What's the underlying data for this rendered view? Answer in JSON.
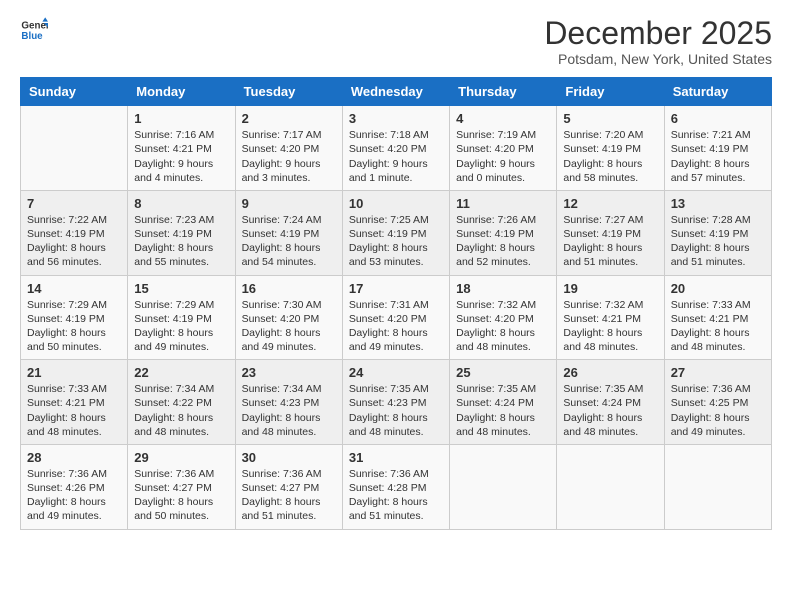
{
  "logo": {
    "line1": "General",
    "line2": "Blue"
  },
  "title": "December 2025",
  "subtitle": "Potsdam, New York, United States",
  "days_of_week": [
    "Sunday",
    "Monday",
    "Tuesday",
    "Wednesday",
    "Thursday",
    "Friday",
    "Saturday"
  ],
  "weeks": [
    [
      {
        "day": "",
        "sunrise": "",
        "sunset": "",
        "daylight": ""
      },
      {
        "day": "1",
        "sunrise": "Sunrise: 7:16 AM",
        "sunset": "Sunset: 4:21 PM",
        "daylight": "Daylight: 9 hours and 4 minutes."
      },
      {
        "day": "2",
        "sunrise": "Sunrise: 7:17 AM",
        "sunset": "Sunset: 4:20 PM",
        "daylight": "Daylight: 9 hours and 3 minutes."
      },
      {
        "day": "3",
        "sunrise": "Sunrise: 7:18 AM",
        "sunset": "Sunset: 4:20 PM",
        "daylight": "Daylight: 9 hours and 1 minute."
      },
      {
        "day": "4",
        "sunrise": "Sunrise: 7:19 AM",
        "sunset": "Sunset: 4:20 PM",
        "daylight": "Daylight: 9 hours and 0 minutes."
      },
      {
        "day": "5",
        "sunrise": "Sunrise: 7:20 AM",
        "sunset": "Sunset: 4:19 PM",
        "daylight": "Daylight: 8 hours and 58 minutes."
      },
      {
        "day": "6",
        "sunrise": "Sunrise: 7:21 AM",
        "sunset": "Sunset: 4:19 PM",
        "daylight": "Daylight: 8 hours and 57 minutes."
      }
    ],
    [
      {
        "day": "7",
        "sunrise": "Sunrise: 7:22 AM",
        "sunset": "Sunset: 4:19 PM",
        "daylight": "Daylight: 8 hours and 56 minutes."
      },
      {
        "day": "8",
        "sunrise": "Sunrise: 7:23 AM",
        "sunset": "Sunset: 4:19 PM",
        "daylight": "Daylight: 8 hours and 55 minutes."
      },
      {
        "day": "9",
        "sunrise": "Sunrise: 7:24 AM",
        "sunset": "Sunset: 4:19 PM",
        "daylight": "Daylight: 8 hours and 54 minutes."
      },
      {
        "day": "10",
        "sunrise": "Sunrise: 7:25 AM",
        "sunset": "Sunset: 4:19 PM",
        "daylight": "Daylight: 8 hours and 53 minutes."
      },
      {
        "day": "11",
        "sunrise": "Sunrise: 7:26 AM",
        "sunset": "Sunset: 4:19 PM",
        "daylight": "Daylight: 8 hours and 52 minutes."
      },
      {
        "day": "12",
        "sunrise": "Sunrise: 7:27 AM",
        "sunset": "Sunset: 4:19 PM",
        "daylight": "Daylight: 8 hours and 51 minutes."
      },
      {
        "day": "13",
        "sunrise": "Sunrise: 7:28 AM",
        "sunset": "Sunset: 4:19 PM",
        "daylight": "Daylight: 8 hours and 51 minutes."
      }
    ],
    [
      {
        "day": "14",
        "sunrise": "Sunrise: 7:29 AM",
        "sunset": "Sunset: 4:19 PM",
        "daylight": "Daylight: 8 hours and 50 minutes."
      },
      {
        "day": "15",
        "sunrise": "Sunrise: 7:29 AM",
        "sunset": "Sunset: 4:19 PM",
        "daylight": "Daylight: 8 hours and 49 minutes."
      },
      {
        "day": "16",
        "sunrise": "Sunrise: 7:30 AM",
        "sunset": "Sunset: 4:20 PM",
        "daylight": "Daylight: 8 hours and 49 minutes."
      },
      {
        "day": "17",
        "sunrise": "Sunrise: 7:31 AM",
        "sunset": "Sunset: 4:20 PM",
        "daylight": "Daylight: 8 hours and 49 minutes."
      },
      {
        "day": "18",
        "sunrise": "Sunrise: 7:32 AM",
        "sunset": "Sunset: 4:20 PM",
        "daylight": "Daylight: 8 hours and 48 minutes."
      },
      {
        "day": "19",
        "sunrise": "Sunrise: 7:32 AM",
        "sunset": "Sunset: 4:21 PM",
        "daylight": "Daylight: 8 hours and 48 minutes."
      },
      {
        "day": "20",
        "sunrise": "Sunrise: 7:33 AM",
        "sunset": "Sunset: 4:21 PM",
        "daylight": "Daylight: 8 hours and 48 minutes."
      }
    ],
    [
      {
        "day": "21",
        "sunrise": "Sunrise: 7:33 AM",
        "sunset": "Sunset: 4:21 PM",
        "daylight": "Daylight: 8 hours and 48 minutes."
      },
      {
        "day": "22",
        "sunrise": "Sunrise: 7:34 AM",
        "sunset": "Sunset: 4:22 PM",
        "daylight": "Daylight: 8 hours and 48 minutes."
      },
      {
        "day": "23",
        "sunrise": "Sunrise: 7:34 AM",
        "sunset": "Sunset: 4:23 PM",
        "daylight": "Daylight: 8 hours and 48 minutes."
      },
      {
        "day": "24",
        "sunrise": "Sunrise: 7:35 AM",
        "sunset": "Sunset: 4:23 PM",
        "daylight": "Daylight: 8 hours and 48 minutes."
      },
      {
        "day": "25",
        "sunrise": "Sunrise: 7:35 AM",
        "sunset": "Sunset: 4:24 PM",
        "daylight": "Daylight: 8 hours and 48 minutes."
      },
      {
        "day": "26",
        "sunrise": "Sunrise: 7:35 AM",
        "sunset": "Sunset: 4:24 PM",
        "daylight": "Daylight: 8 hours and 48 minutes."
      },
      {
        "day": "27",
        "sunrise": "Sunrise: 7:36 AM",
        "sunset": "Sunset: 4:25 PM",
        "daylight": "Daylight: 8 hours and 49 minutes."
      }
    ],
    [
      {
        "day": "28",
        "sunrise": "Sunrise: 7:36 AM",
        "sunset": "Sunset: 4:26 PM",
        "daylight": "Daylight: 8 hours and 49 minutes."
      },
      {
        "day": "29",
        "sunrise": "Sunrise: 7:36 AM",
        "sunset": "Sunset: 4:27 PM",
        "daylight": "Daylight: 8 hours and 50 minutes."
      },
      {
        "day": "30",
        "sunrise": "Sunrise: 7:36 AM",
        "sunset": "Sunset: 4:27 PM",
        "daylight": "Daylight: 8 hours and 51 minutes."
      },
      {
        "day": "31",
        "sunrise": "Sunrise: 7:36 AM",
        "sunset": "Sunset: 4:28 PM",
        "daylight": "Daylight: 8 hours and 51 minutes."
      },
      {
        "day": "",
        "sunrise": "",
        "sunset": "",
        "daylight": ""
      },
      {
        "day": "",
        "sunrise": "",
        "sunset": "",
        "daylight": ""
      },
      {
        "day": "",
        "sunrise": "",
        "sunset": "",
        "daylight": ""
      }
    ]
  ]
}
